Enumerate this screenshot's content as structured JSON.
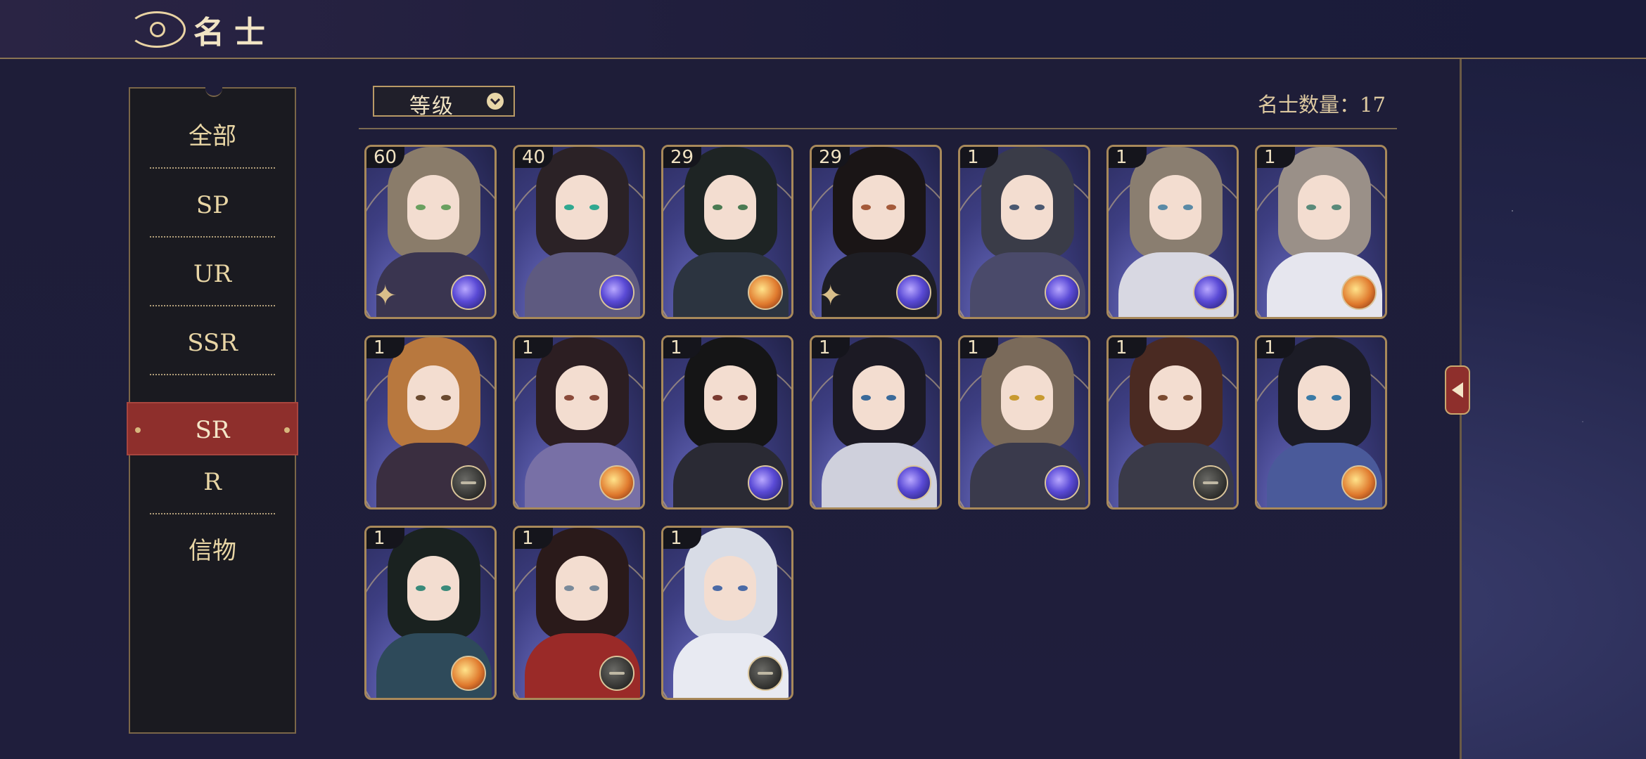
{
  "header": {
    "title": "名士"
  },
  "sidebar": {
    "items": [
      {
        "label": "全部"
      },
      {
        "label": "SP"
      },
      {
        "label": "UR"
      },
      {
        "label": "SSR"
      },
      {
        "label": "SR",
        "active": true
      },
      {
        "label": "R"
      },
      {
        "label": "信物"
      }
    ]
  },
  "toolbar": {
    "sort_label": "等级",
    "count_text": "名士数量：17"
  },
  "colors": {
    "accent_gold": "#e6cf9a",
    "active_tab": "#8e2f2c",
    "panel": "#1e1d38"
  },
  "cards": [
    {
      "level": "60",
      "orb": "orb-blue",
      "hair": "#8a7c6a",
      "body": "#3a3550",
      "eye": "#6aa060",
      "spark": true
    },
    {
      "level": "40",
      "orb": "orb-blue",
      "hair": "#2b2226",
      "body": "#5e5a80",
      "eye": "#30a890",
      "spark": false
    },
    {
      "level": "29",
      "orb": "orb-gold",
      "hair": "#1e2424",
      "body": "#2c3440",
      "eye": "#4a7a52",
      "spark": false
    },
    {
      "level": "29",
      "orb": "orb-blue",
      "hair": "#1a1516",
      "body": "#1e1e24",
      "eye": "#a45a3a",
      "spark": true
    },
    {
      "level": "1",
      "orb": "orb-blue",
      "hair": "#3a3c48",
      "body": "#4a4a6a",
      "eye": "#4a5870",
      "spark": false
    },
    {
      "level": "1",
      "orb": "orb-blue",
      "hair": "#8a7e70",
      "body": "#d8d8e2",
      "eye": "#5a8aa6",
      "spark": false
    },
    {
      "level": "1",
      "orb": "orb-gold",
      "hair": "#9a9088",
      "body": "#e6e6ee",
      "eye": "#5a8a7a",
      "spark": false
    },
    {
      "level": "1",
      "orb": "orb-gray",
      "hair": "#b8783e",
      "body": "#3a2e40",
      "eye": "#6a4a30",
      "spark": false
    },
    {
      "level": "1",
      "orb": "orb-gold",
      "hair": "#2c1e22",
      "body": "#7870a6",
      "eye": "#8a4a3a",
      "spark": false
    },
    {
      "level": "1",
      "orb": "orb-blue",
      "hair": "#151516",
      "body": "#2a2a34",
      "eye": "#7a3a30",
      "spark": false
    },
    {
      "level": "1",
      "orb": "orb-blue",
      "hair": "#1c1a24",
      "body": "#cfd0dc",
      "eye": "#3a6a9a",
      "spark": false
    },
    {
      "level": "1",
      "orb": "orb-blue",
      "hair": "#7a6a5a",
      "body": "#3a3a4c",
      "eye": "#c89a30",
      "spark": false
    },
    {
      "level": "1",
      "orb": "orb-gray",
      "hair": "#4a2a22",
      "body": "#3a3a48",
      "eye": "#7a4a30",
      "spark": false
    },
    {
      "level": "1",
      "orb": "orb-gold",
      "hair": "#1c1c26",
      "body": "#4a5a9a",
      "eye": "#3a7aa6",
      "spark": false
    },
    {
      "level": "1",
      "orb": "orb-gold",
      "hair": "#1a2220",
      "body": "#2e4a5a",
      "eye": "#3a8a7a",
      "spark": false
    },
    {
      "level": "1",
      "orb": "orb-gray",
      "hair": "#2a1a1a",
      "body": "#9a2a28",
      "eye": "#7a8a9a",
      "spark": false
    },
    {
      "level": "1",
      "orb": "orb-gray",
      "hair": "#d8dce6",
      "body": "#e8eaf2",
      "eye": "#4a6aa6",
      "spark": false
    }
  ]
}
